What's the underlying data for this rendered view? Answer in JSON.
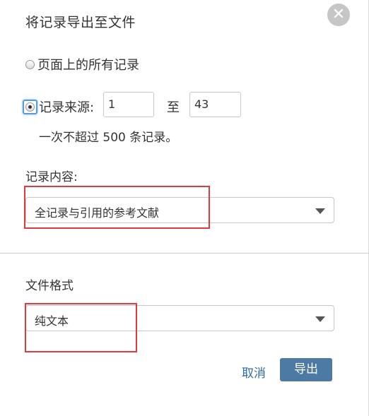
{
  "dialog": {
    "title": "将记录导出至文件",
    "close_icon": "close-icon"
  },
  "records": {
    "option_all_label": "页面上的所有记录",
    "option_range_label": "记录来源:",
    "range_from": "1",
    "range_to_label": "至",
    "range_to": "43",
    "hint": "一次不超过 500 条记录。",
    "selected_option": "range"
  },
  "content": {
    "label": "记录内容:",
    "value": "全记录与引用的参考文献"
  },
  "format": {
    "label": "文件格式",
    "value": "纯文本"
  },
  "actions": {
    "cancel_label": "取消",
    "export_label": "导出"
  },
  "colors": {
    "accent": "#4d7aa5",
    "link": "#2e6da4",
    "annotation_red": "#e0393e"
  }
}
